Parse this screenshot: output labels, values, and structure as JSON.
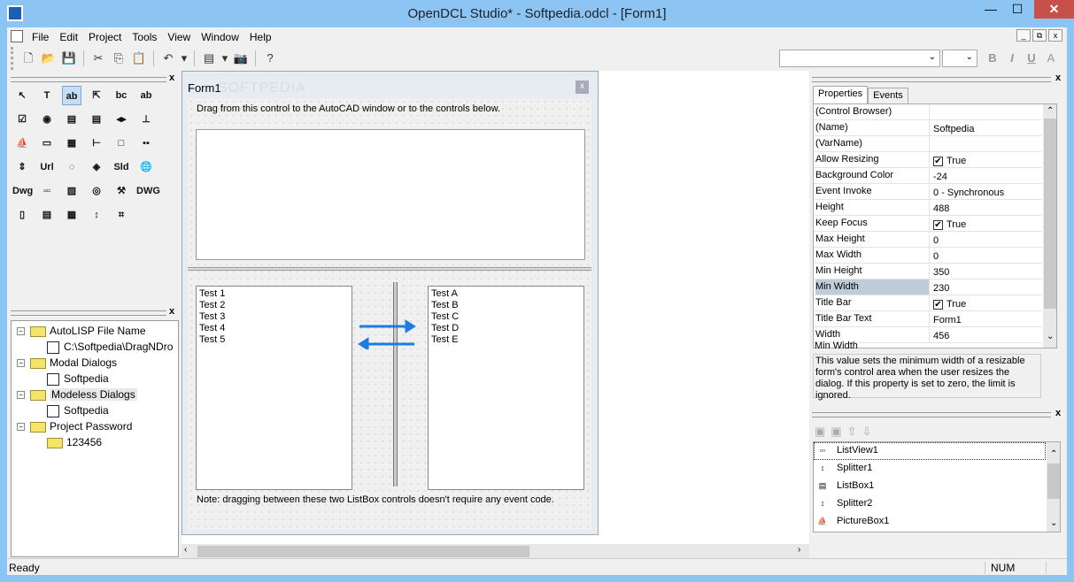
{
  "window": {
    "title": "OpenDCL Studio* - Softpedia.odcl - [Form1]",
    "min": "—",
    "max": "☐",
    "close": "✕"
  },
  "menu": [
    "File",
    "Edit",
    "Project",
    "Tools",
    "View",
    "Window",
    "Help"
  ],
  "mdi_buttons": [
    "_",
    "⧉",
    "x"
  ],
  "toolbar": {
    "icons": [
      "new-icon",
      "open-icon",
      "save-icon",
      "cut-icon",
      "copy-icon",
      "paste-icon",
      "undo-icon",
      "dropdown-icon",
      "form-icon",
      "dropdown-icon",
      "camera-icon",
      "help-icon"
    ],
    "glyphs": [
      "🗋",
      "📂",
      "💾",
      "✂",
      "⎘",
      "📋",
      "↶",
      "▾",
      "▤",
      "▾",
      "📷",
      "?"
    ]
  },
  "format_bar": {
    "font": "",
    "size": "",
    "bold": "B",
    "italic": "I",
    "underline": "U",
    "align": "A"
  },
  "toolbox": {
    "tools": [
      "↖",
      "T",
      "ab",
      "⇱",
      "bc",
      "ab",
      "☑",
      "◉",
      "▤",
      "▤",
      "◂▸",
      "⊥",
      "⛵",
      "▭",
      "▦",
      "⊢",
      "□",
      "▪▪",
      "⇕",
      "Url",
      "◌",
      "◈",
      "Sld",
      "🌐",
      "Dwg",
      "▫▫",
      "▨",
      "◎",
      "⚒",
      "DWG",
      "▯",
      "▤",
      "▦",
      "↕",
      "⌗"
    ],
    "selected": 2
  },
  "tree": {
    "items": [
      {
        "label": "AutoLISP File Name",
        "level": 0,
        "type": "folder"
      },
      {
        "label": "C:\\Softpedia\\DragNDro",
        "level": 1,
        "type": "lisp"
      },
      {
        "label": "Modal Dialogs",
        "level": 0,
        "type": "folder"
      },
      {
        "label": "Softpedia",
        "level": 1,
        "type": "dialog"
      },
      {
        "label": "Modeless Dialogs",
        "level": 0,
        "type": "folder",
        "selected": true
      },
      {
        "label": "Softpedia",
        "level": 1,
        "type": "dialog"
      },
      {
        "label": "Project Password",
        "level": 0,
        "type": "folder"
      },
      {
        "label": "123456",
        "level": 1,
        "type": "folder"
      }
    ]
  },
  "form": {
    "title": "Form1",
    "watermark": "SOFTPEDIA",
    "close": "x",
    "instruction": "Drag from this control to the AutoCAD window or to the controls below.",
    "left_list": [
      "Test 1",
      "Test 2",
      "Test 3",
      "Test 4",
      "Test 5"
    ],
    "right_list": [
      "Test A",
      "Test B",
      "Test C",
      "Test D",
      "Test E"
    ],
    "note": "Note: dragging between these two ListBox controls doesn't require any event code.",
    "arrow_color": "#1e7be0"
  },
  "properties": {
    "tabs": [
      "Properties",
      "Events"
    ],
    "active_tab": 0,
    "rows": [
      {
        "name": "(Control Browser)",
        "value": ""
      },
      {
        "name": "(Name)",
        "value": "Softpedia"
      },
      {
        "name": "(VarName)",
        "value": ""
      },
      {
        "name": "Allow Resizing",
        "value": "True",
        "checked": true
      },
      {
        "name": "Background Color",
        "value": "-24"
      },
      {
        "name": "Event Invoke",
        "value": "0 - Synchronous"
      },
      {
        "name": "Height",
        "value": "488"
      },
      {
        "name": "Keep Focus",
        "value": "True",
        "checked": true
      },
      {
        "name": "Max Height",
        "value": "0"
      },
      {
        "name": "Max Width",
        "value": "0"
      },
      {
        "name": "Min Height",
        "value": "350"
      },
      {
        "name": "Min Width",
        "value": "230",
        "selected": true
      },
      {
        "name": "Title Bar",
        "value": "True",
        "checked": true
      },
      {
        "name": "Title Bar Text",
        "value": "Form1"
      },
      {
        "name": "Width",
        "value": "456"
      }
    ],
    "desc_title": "Min Width",
    "desc_text": "This value sets the minimum width of a resizable form's control area when the user resizes the dialog. If this property is set to zero, the limit is ignored."
  },
  "controls": {
    "items": [
      {
        "label": "ListView1",
        "icon": "listview-icon",
        "glyph": "▫▫"
      },
      {
        "label": "Splitter1",
        "icon": "splitter-icon",
        "glyph": "↕"
      },
      {
        "label": "ListBox1",
        "icon": "listbox-icon",
        "glyph": "▤"
      },
      {
        "label": "Splitter2",
        "icon": "splitter-icon",
        "glyph": "↕"
      },
      {
        "label": "PictureBox1",
        "icon": "picturebox-icon",
        "glyph": "⛵"
      }
    ]
  },
  "status": {
    "text": "Ready",
    "num": "NUM"
  }
}
